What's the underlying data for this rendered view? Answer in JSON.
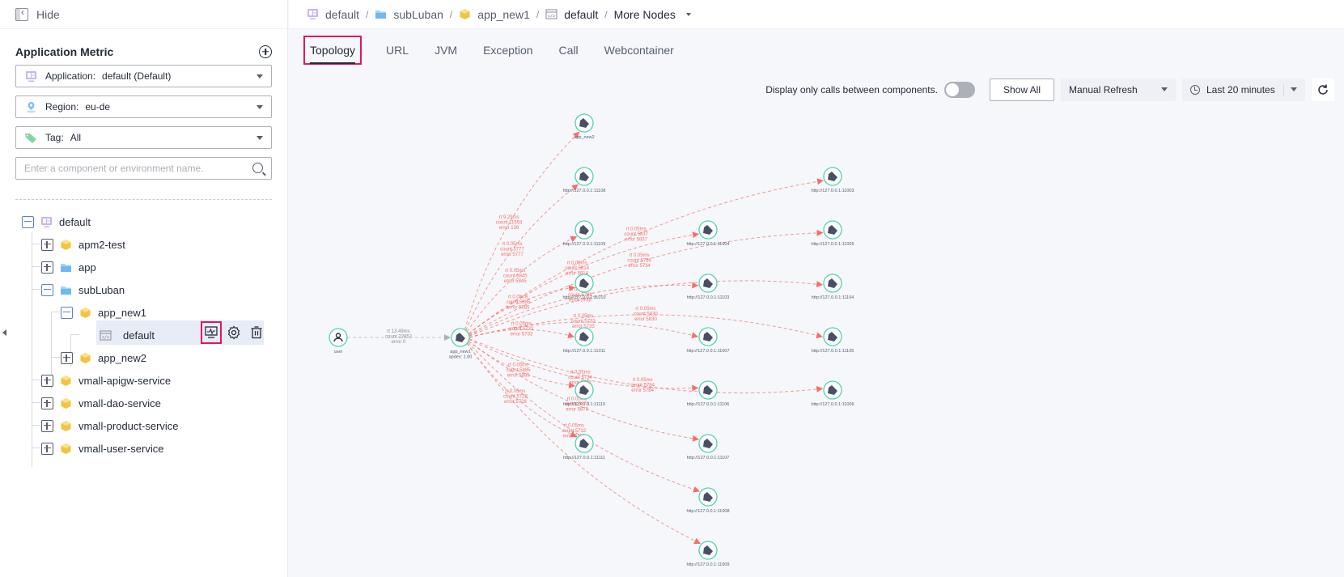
{
  "sidebar": {
    "hide_label": "Hide",
    "title": "Application Metric",
    "application": {
      "label": "Application:",
      "value": "default (Default)"
    },
    "region": {
      "label": "Region:",
      "value": "eu-de"
    },
    "tag": {
      "label": "Tag:",
      "value": "All"
    },
    "search_placeholder": "Enter a component or environment name.",
    "tree": [
      {
        "label": "default",
        "icon": "application-icon",
        "state": "open"
      },
      {
        "label": "apm2-test",
        "icon": "component-icon",
        "state": "closed"
      },
      {
        "label": "app",
        "icon": "folder-icon",
        "state": "closed"
      },
      {
        "label": "subLuban",
        "icon": "folder-icon",
        "state": "open"
      },
      {
        "label": "app_new1",
        "icon": "component-icon",
        "state": "open"
      },
      {
        "label": "default",
        "icon": "environment-icon",
        "state": "leaf",
        "selected": true
      },
      {
        "label": "app_new2",
        "icon": "component-icon",
        "state": "closed"
      },
      {
        "label": "vmall-apigw-service",
        "icon": "component-icon",
        "state": "closed"
      },
      {
        "label": "vmall-dao-service",
        "icon": "component-icon",
        "state": "closed"
      },
      {
        "label": "vmall-product-service",
        "icon": "component-icon",
        "state": "closed"
      },
      {
        "label": "vmall-user-service",
        "icon": "component-icon",
        "state": "closed"
      }
    ],
    "row_actions": [
      "monitor-icon",
      "gear-icon",
      "trash-icon"
    ]
  },
  "breadcrumb": {
    "items": [
      {
        "label": "default",
        "icon": "application-icon"
      },
      {
        "label": "subLuban",
        "icon": "folder-icon"
      },
      {
        "label": "app_new1",
        "icon": "component-icon"
      },
      {
        "label": "default",
        "icon": "environment-icon"
      }
    ],
    "more": "More Nodes"
  },
  "tabs": [
    {
      "label": "Topology",
      "active": true
    },
    {
      "label": "URL"
    },
    {
      "label": "JVM"
    },
    {
      "label": "Exception"
    },
    {
      "label": "Call"
    },
    {
      "label": "Webcontainer"
    }
  ],
  "toolbar": {
    "toggle_label": "Display only calls between components.",
    "toggle_on": false,
    "show_all": "Show All",
    "refresh_mode": "Manual Refresh",
    "time_range": "Last 20 minutes"
  },
  "colors": {
    "accent": "#5e7ce0",
    "highlight": "#e0175d",
    "node_ring": "#50d4ab",
    "edge": "#f66f6a",
    "edge_normal": "#adb0b8"
  },
  "topology": {
    "nodes": [
      {
        "id": "user",
        "label": "user",
        "type": "user"
      },
      {
        "id": "app_new1",
        "label": "app_new1",
        "sublabel": "apdex: 1.00",
        "type": "service"
      },
      {
        "id": "app_new2",
        "label": "app_new2",
        "type": "service"
      },
      {
        "id": "n11108",
        "label": "http://127.0.0.1:11108",
        "type": "service"
      },
      {
        "id": "n11109",
        "label": "http://127.0.0.1:11109",
        "type": "service"
      },
      {
        "id": "n11010",
        "label": "http://127.0.0.1:11010",
        "type": "service"
      },
      {
        "id": "n11011",
        "label": "http://127.0.0.1:11011",
        "type": "service"
      },
      {
        "id": "n11110",
        "label": "http://127.0.0.1:11110",
        "type": "service"
      },
      {
        "id": "n11111",
        "label": "http://127.0.0.1:11111",
        "type": "service"
      },
      {
        "id": "n11004",
        "label": "http://127.0.0.1:11004",
        "type": "service"
      },
      {
        "id": "n11103",
        "label": "http://127.0.0.1:11103",
        "type": "service"
      },
      {
        "id": "n11007",
        "label": "http://127.0.0.1:11007",
        "type": "service"
      },
      {
        "id": "n11106",
        "label": "http://127.0.0.1:11106",
        "type": "service"
      },
      {
        "id": "n11107",
        "label": "http://127.0.0.1:11107",
        "type": "service"
      },
      {
        "id": "n11008",
        "label": "http://127.0.0.1:11008",
        "type": "service"
      },
      {
        "id": "n11009",
        "label": "http://127.0.0.1:11009",
        "type": "service"
      },
      {
        "id": "n11003",
        "label": "http://127.0.0.1:11003",
        "type": "service"
      },
      {
        "id": "n11005",
        "label": "http://127.0.0.1:11005",
        "type": "service"
      },
      {
        "id": "n11104",
        "label": "http://127.0.0.1:11104",
        "type": "service"
      },
      {
        "id": "n11105",
        "label": "http://127.0.0.1:11105",
        "type": "service"
      },
      {
        "id": "n11006",
        "label": "http://127.0.0.1:11006",
        "type": "service"
      }
    ],
    "edges": [
      {
        "from": "user",
        "to": "app_new1",
        "rt": "rt 13.49ms",
        "count": "count 22852",
        "error": "error 0",
        "status": "normal"
      },
      {
        "from": "app_new1",
        "to": "app_new2",
        "rt": "rt 9.29ms",
        "count": "count 11553",
        "error": "error 139",
        "status": "error"
      },
      {
        "from": "app_new1",
        "to": "n11108",
        "rt": "rt 0.05ms",
        "count": "count 5777",
        "error": "error 5777",
        "status": "error"
      },
      {
        "from": "app_new1",
        "to": "n11109",
        "rt": "rt 0.05ms",
        "count": "count 5845",
        "error": "error 5845",
        "status": "error"
      },
      {
        "from": "app_new1",
        "to": "n11010",
        "rt": "rt 0.05ms",
        "count": "count 5885",
        "error": "error 5885",
        "status": "error"
      },
      {
        "from": "app_new1",
        "to": "n11011",
        "rt": "rt 0.05ms",
        "count": "count 5733",
        "error": "error 5733",
        "status": "error"
      },
      {
        "from": "app_new1",
        "to": "n11110",
        "rt": "rt 0.05ms",
        "count": "count 5885",
        "error": "error 5885",
        "status": "error"
      },
      {
        "from": "app_new1",
        "to": "n11111",
        "rt": "rt 0.05ms",
        "count": "count 5728",
        "error": "error 5728",
        "status": "error"
      },
      {
        "from": "app_new1",
        "to": "n11004",
        "rt": "rt 0.05ms",
        "count": "count 5814",
        "error": "error 5814",
        "status": "error"
      },
      {
        "from": "app_new1",
        "to": "n11103",
        "rt": "rt 0.05ms",
        "count": "count 5748",
        "error": "error 5748",
        "status": "error"
      },
      {
        "from": "app_new1",
        "to": "n11007",
        "rt": "rt 0.05ms",
        "count": "count 5733",
        "error": "error 5733",
        "status": "error"
      },
      {
        "from": "app_new1",
        "to": "n11106",
        "rt": "rt 0.05ms",
        "count": "count 5734",
        "error": "error 5734",
        "status": "error"
      },
      {
        "from": "app_new1",
        "to": "n11107",
        "rt": "rt 0.05ms",
        "count": "count 5870",
        "error": "error 5870",
        "status": "error"
      },
      {
        "from": "app_new1",
        "to": "n11008",
        "rt": "rt 0.05ms",
        "count": "count 5732",
        "error": "error 5732",
        "status": "error"
      },
      {
        "from": "app_new1",
        "to": "n11009",
        "rt": "",
        "count": "",
        "error": "",
        "status": "error"
      },
      {
        "from": "app_new1",
        "to": "n11003",
        "rt": "rt 0.05ms",
        "count": "count 5837",
        "error": "error 5837",
        "status": "error"
      },
      {
        "from": "app_new1",
        "to": "n11005",
        "rt": "rt 0.05ms",
        "count": "count 5734",
        "error": "error 5734",
        "status": "error"
      },
      {
        "from": "app_new1",
        "to": "n11104",
        "rt": "",
        "count": "",
        "error": "",
        "status": "error"
      },
      {
        "from": "app_new1",
        "to": "n11105",
        "rt": "rt 0.05ms",
        "count": "count 5830",
        "error": "error 5830",
        "status": "error"
      },
      {
        "from": "app_new1",
        "to": "n11006",
        "rt": "rt 0.05ms",
        "count": "count 5784",
        "error": "error 5784",
        "status": "error"
      }
    ]
  }
}
